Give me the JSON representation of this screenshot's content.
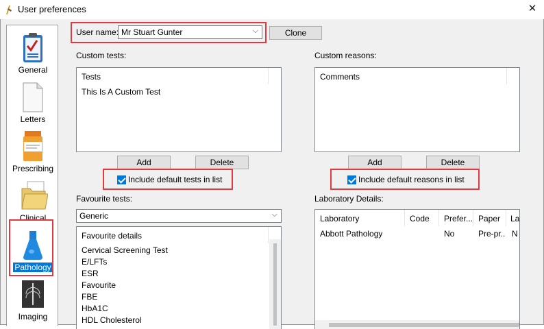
{
  "window": {
    "title": "User preferences",
    "close": "✕"
  },
  "sidebar": {
    "items": [
      {
        "label": "General",
        "icon": "clipboard-icon"
      },
      {
        "label": "Letters",
        "icon": "document-icon"
      },
      {
        "label": "Prescribing",
        "icon": "pill-bottle-icon"
      },
      {
        "label": "Clinical",
        "icon": "folder-icon"
      },
      {
        "label": "Pathology",
        "icon": "flask-icon",
        "selected": true
      },
      {
        "label": "Imaging",
        "icon": "xray-icon"
      }
    ]
  },
  "user": {
    "label": "User name:",
    "value": "Mr Stuart Gunter",
    "clone_label": "Clone"
  },
  "custom_tests": {
    "label": "Custom tests:",
    "column": "Tests",
    "rows": [
      "This Is A Custom Test"
    ],
    "add_label": "Add",
    "delete_label": "Delete",
    "include_default_label": "Include default tests in list",
    "include_default_checked": true
  },
  "custom_reasons": {
    "label": "Custom reasons:",
    "column": "Comments",
    "rows": [],
    "add_label": "Add",
    "delete_label": "Delete",
    "include_default_label": "Include default reasons in list",
    "include_default_checked": true
  },
  "favourite_tests": {
    "label": "Favourite tests:",
    "selected_group": "Generic",
    "column": "Favourite details",
    "rows": [
      "Cervical Screening Test",
      "E/LFTs",
      "ESR",
      "Favourite",
      "FBE",
      "HbA1C",
      "HDL Cholesterol"
    ]
  },
  "laboratory": {
    "label": "Laboratory Details:",
    "columns": [
      "Laboratory",
      "Code",
      "Prefer...",
      "Paper",
      "La"
    ],
    "rows": [
      [
        "Abbott Pathology",
        "",
        "No",
        "Pre-pr...",
        "N"
      ]
    ]
  },
  "colors": {
    "highlight": "#e0393e",
    "selection": "#0078d7"
  }
}
